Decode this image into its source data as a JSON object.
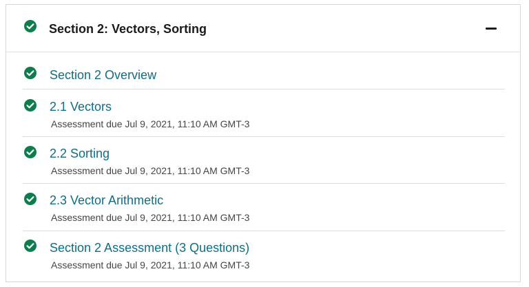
{
  "section": {
    "title": "Section 2: Vectors, Sorting",
    "collapse_icon": "minus-icon",
    "status_icon": "check-circle-icon"
  },
  "colors": {
    "check": "#0d7d4d",
    "link": "#0f6e84"
  },
  "units": [
    {
      "title": "Section 2 Overview",
      "due": ""
    },
    {
      "title": "2.1 Vectors",
      "due": "Assessment due Jul 9, 2021, 11:10 AM GMT-3"
    },
    {
      "title": "2.2 Sorting",
      "due": "Assessment due Jul 9, 2021, 11:10 AM GMT-3"
    },
    {
      "title": "2.3 Vector Arithmetic",
      "due": "Assessment due Jul 9, 2021, 11:10 AM GMT-3"
    },
    {
      "title": "Section 2 Assessment (3 Questions)",
      "due": "Assessment due Jul 9, 2021, 11:10 AM GMT-3"
    }
  ]
}
